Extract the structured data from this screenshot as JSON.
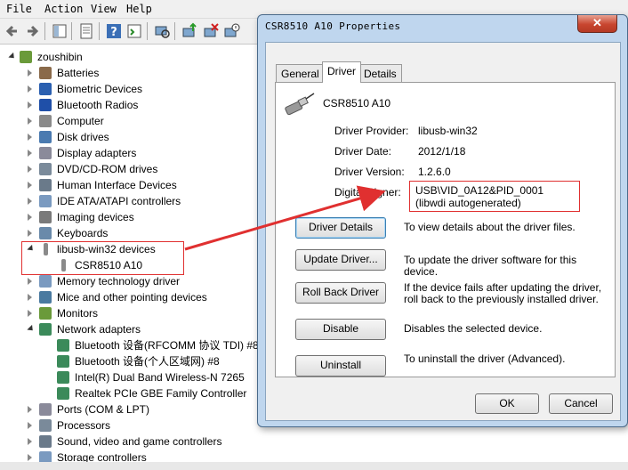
{
  "menu": [
    "File",
    "Action",
    "View",
    "Help"
  ],
  "tree": {
    "root": "zoushibin",
    "categories": [
      "Batteries",
      "Biometric Devices",
      "Bluetooth Radios",
      "Computer",
      "Disk drives",
      "Display adapters",
      "DVD/CD-ROM drives",
      "Human Interface Devices",
      "IDE ATA/ATAPI controllers",
      "Imaging devices",
      "Keyboards"
    ],
    "usb_group": "libusb-win32 devices",
    "usb_child": "CSR8510 A10",
    "categories2": [
      "Memory technology driver",
      "Mice and other pointing devices",
      "Monitors"
    ],
    "network_group": "Network adapters",
    "network_children": [
      "Bluetooth 设备(RFCOMM 协议 TDI) #8",
      "Bluetooth 设备(个人区域网) #8",
      "Intel(R) Dual Band Wireless-N 7265",
      "Realtek PCIe GBE Family Controller"
    ],
    "categories3": [
      "Ports (COM & LPT)",
      "Processors",
      "Sound, video and game controllers",
      "Storage controllers"
    ]
  },
  "dialog": {
    "title": "CSR8510 A10 Properties",
    "close": "✕",
    "tabs": [
      "General",
      "Driver",
      "Details"
    ],
    "device_name": "CSR8510 A10",
    "props": [
      {
        "label": "Driver Provider:",
        "value": "libusb-win32"
      },
      {
        "label": "Driver Date:",
        "value": "2012/1/18"
      },
      {
        "label": "Driver Version:",
        "value": "1.2.6.0"
      }
    ],
    "signer_label": "Digital Signer:",
    "signer_value": "USB\\VID_0A12&PID_0001 (libwdi autogenerated)",
    "buttons": [
      {
        "label": "Driver Details",
        "desc": "To view details about the driver files."
      },
      {
        "label": "Update Driver...",
        "desc": "To update the driver software for this device."
      },
      {
        "label": "Roll Back Driver",
        "desc": "If the device fails after updating the driver, roll back to the previously installed driver."
      },
      {
        "label": "Disable",
        "desc": "Disables the selected device."
      },
      {
        "label": "Uninstall",
        "desc": "To uninstall the driver (Advanced)."
      }
    ],
    "ok": "OK",
    "cancel": "Cancel"
  },
  "colors": {
    "annotation": "#e03030",
    "dialog_frame": "#bfd6ee"
  }
}
